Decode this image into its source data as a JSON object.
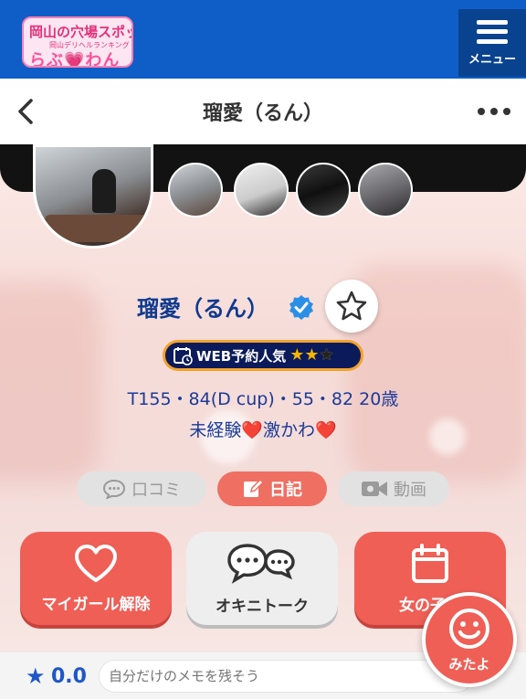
{
  "header": {
    "logo_line1": "岡山の穴場スポット",
    "logo_line2": "岡山デリヘルランキング",
    "logo_line3": "らぶ💗わん",
    "menu_label": "メニュー"
  },
  "titlebar": {
    "title": "瑠愛（るん）",
    "back_icon": "chevron-left-icon",
    "more_icon": "more-horizontal-icon"
  },
  "profile": {
    "name": "瑠愛（るん）",
    "verified_icon": "verified-check-icon",
    "favorite_icon": "star-outline-icon",
    "badge_label": "WEB予約人気",
    "badge_rating": 2,
    "badge_rating_max": 3,
    "specs": "T155・84(D cup)・55・82  20歳",
    "tagline_part1": "未経験",
    "tagline_part2": "激かわ",
    "heart_glyph": "❤️"
  },
  "tabs": [
    {
      "label": "口コミ",
      "icon": "speech-bubble-icon",
      "active": false
    },
    {
      "label": "日記",
      "icon": "edit-icon",
      "active": true
    },
    {
      "label": "動画",
      "icon": "video-camera-icon",
      "active": false
    }
  ],
  "actions": [
    {
      "label": "マイガール解除",
      "icon": "heart-outline-icon"
    },
    {
      "label": "オキニトーク",
      "icon": "chat-bubbles-icon"
    },
    {
      "label": "女の子予",
      "icon": "calendar-icon"
    }
  ],
  "memo": {
    "score": "0.0",
    "placeholder": "自分だけのメモを残そう"
  },
  "fab": {
    "label": "みたよ",
    "icon": "smiley-icon"
  },
  "colors": {
    "header_blue": "#0f5ec8",
    "menu_blue": "#09438f",
    "accent_red": "#ef5f56",
    "text_navy": "#1a3a9a",
    "badge_gold": "#f3a22b"
  }
}
